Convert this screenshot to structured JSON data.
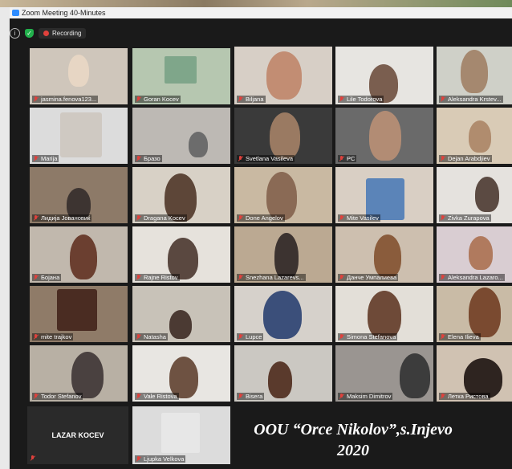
{
  "window": {
    "title": "Zoom Meeting 40-Minutes"
  },
  "toolbar": {
    "recording_label": "Recording"
  },
  "watermark": {
    "line1": "OOU “Orce Nikolov”,s.Injevo",
    "line2": "2020"
  },
  "participants": [
    {
      "name": "jasmina.fenova123...",
      "bg": "#cfc6bb"
    },
    {
      "name": "Goran Kocev",
      "bg": "#b6c7b0"
    },
    {
      "name": "Biljana",
      "bg": "#d7cfc6"
    },
    {
      "name": "Lile Todorova",
      "bg": "#e7e5e1"
    },
    {
      "name": "Aleksandra Krstev...",
      "bg": "#cfd0c8"
    },
    {
      "name": "Marija",
      "bg": "#dcdcdc"
    },
    {
      "name": "Бразо",
      "bg": "#bdb9b4"
    },
    {
      "name": "Svetlana Vasileva",
      "bg": "#3a3a3a"
    },
    {
      "name": "PC",
      "bg": "#6a6a6a"
    },
    {
      "name": "Dejan Arabdjiev",
      "bg": "#d9cbb6"
    },
    {
      "name": "Лидија Јовановиќ",
      "bg": "#8d7a68"
    },
    {
      "name": "Dragana Kocev",
      "bg": "#d8d1c6"
    },
    {
      "name": "Done Angelov",
      "bg": "#c9b9a2"
    },
    {
      "name": "Mite Vasilev",
      "bg": "#d9cfc4"
    },
    {
      "name": "Zivka Zurapova",
      "bg": "#e5e2de"
    },
    {
      "name": "Бојана",
      "bg": "#c1b8ad"
    },
    {
      "name": "Rajne Ristov",
      "bg": "#e6e2dc"
    },
    {
      "name": "Snezhana Lazarevs...",
      "bg": "#bba992"
    },
    {
      "name": "Данче Умпалиева",
      "bg": "#cdbfaf"
    },
    {
      "name": "Aleksandra Lazaro...",
      "bg": "#d9cdd2"
    },
    {
      "name": "mite trajkov",
      "bg": "#8f7b68"
    },
    {
      "name": "Natasha",
      "bg": "#c8c2b8"
    },
    {
      "name": "Lupce",
      "bg": "#d6d1cb"
    },
    {
      "name": "Simona Stefanova",
      "bg": "#e3dfd8"
    },
    {
      "name": "Elena Ilieva",
      "bg": "#c9bba6"
    },
    {
      "name": "Todor Stefanov",
      "bg": "#b8b0a4"
    },
    {
      "name": "Vale Ristova",
      "bg": "#e8e6e2"
    },
    {
      "name": "Bisera",
      "bg": "#cbc8c2"
    },
    {
      "name": "Maksim Dimitrov",
      "bg": "#9a9591"
    },
    {
      "name": "Летка Ристова",
      "bg": "#d0c2b2"
    },
    {
      "name": "LAZAR KOCEV",
      "bg": "#2a2a2a"
    },
    {
      "name": "Ljupka Velkova",
      "bg": "#dcdcdc"
    }
  ]
}
